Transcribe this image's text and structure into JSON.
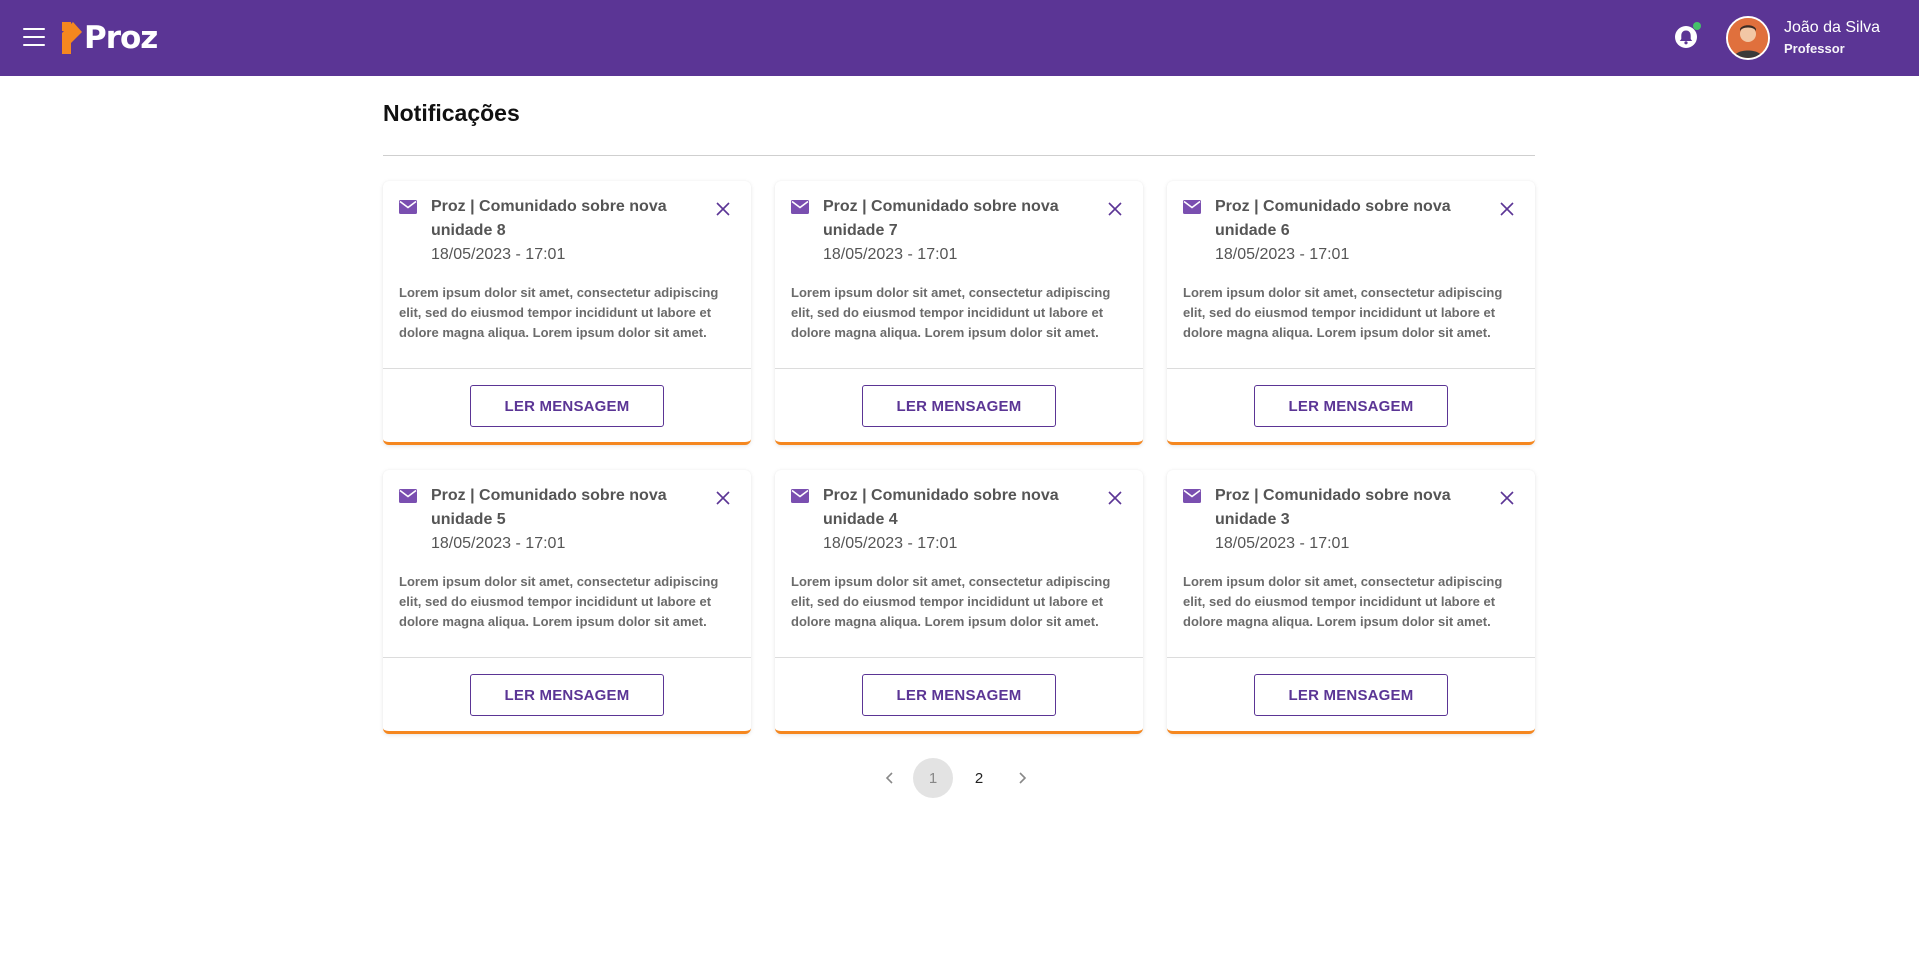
{
  "header": {
    "logo_text": "Proz",
    "user": {
      "name": "João da Silva",
      "role": "Professor"
    },
    "colors": {
      "brand": "#5b3595",
      "accent": "#f5871f",
      "online": "#46c26a"
    }
  },
  "main": {
    "title": "Notificações",
    "cards": [
      {
        "title": "Proz | Comunidado sobre nova unidade 8",
        "date": "18/05/2023 - 17:01",
        "body": "Lorem ipsum dolor sit amet, consectetur adipiscing elit, sed do eiusmod tempor incididunt ut labore et dolore magna aliqua. Lorem ipsum dolor sit amet.",
        "button": "LER MENSAGEM"
      },
      {
        "title": "Proz | Comunidado sobre nova unidade 7",
        "date": "18/05/2023 - 17:01",
        "body": "Lorem ipsum dolor sit amet, consectetur adipiscing elit, sed do eiusmod tempor incididunt ut labore et dolore magna aliqua. Lorem ipsum dolor sit amet.",
        "button": "LER MENSAGEM"
      },
      {
        "title": "Proz | Comunidado sobre nova unidade 6",
        "date": "18/05/2023 - 17:01",
        "body": "Lorem ipsum dolor sit amet, consectetur adipiscing elit, sed do eiusmod tempor incididunt ut labore et dolore magna aliqua. Lorem ipsum dolor sit amet.",
        "button": "LER MENSAGEM"
      },
      {
        "title": "Proz | Comunidado sobre nova unidade 5",
        "date": "18/05/2023 - 17:01",
        "body": "Lorem ipsum dolor sit amet, consectetur adipiscing elit, sed do eiusmod tempor incididunt ut labore et dolore magna aliqua. Lorem ipsum dolor sit amet.",
        "button": "LER MENSAGEM"
      },
      {
        "title": "Proz | Comunidado sobre nova unidade 4",
        "date": "18/05/2023 - 17:01",
        "body": "Lorem ipsum dolor sit amet, consectetur adipiscing elit, sed do eiusmod tempor incididunt ut labore et dolore magna aliqua. Lorem ipsum dolor sit amet.",
        "button": "LER MENSAGEM"
      },
      {
        "title": "Proz | Comunidado sobre nova unidade 3",
        "date": "18/05/2023 - 17:01",
        "body": "Lorem ipsum dolor sit amet, consectetur adipiscing elit, sed do eiusmod tempor incididunt ut labore et dolore magna aliqua. Lorem ipsum dolor sit amet.",
        "button": "LER MENSAGEM"
      }
    ]
  },
  "pagination": {
    "pages": [
      "1",
      "2"
    ],
    "current": "1"
  }
}
